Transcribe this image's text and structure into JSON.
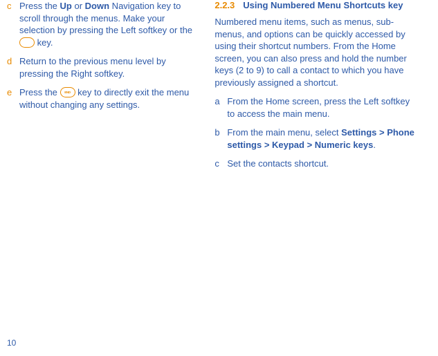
{
  "page_number": "10",
  "left": {
    "items": [
      {
        "marker": "c",
        "segments": [
          {
            "text": "Press the "
          },
          {
            "text": "Up",
            "bold": true
          },
          {
            "text": " or "
          },
          {
            "text": "Down",
            "bold": true
          },
          {
            "text": " Navigation key to scroll through the menus. Make your selection by pressing the Left softkey or the "
          },
          {
            "icon": "ok-key"
          },
          {
            "text": " key."
          }
        ]
      },
      {
        "marker": "d",
        "segments": [
          {
            "text": "Return to the previous menu level by pressing the Right softkey."
          }
        ]
      },
      {
        "marker": "e",
        "segments": [
          {
            "text": "Press the "
          },
          {
            "icon": "end-key",
            "label": "END"
          },
          {
            "text": " key to directly exit the menu without changing any settings."
          }
        ]
      }
    ]
  },
  "right": {
    "section_number": "2.2.3",
    "section_title": "Using Numbered Menu Shortcuts key",
    "intro": "Numbered menu items, such as menus, sub-menus, and options can be quickly accessed by using their shortcut numbers. From the Home screen, you can also press and hold the number keys (2 to 9) to call a contact to which you have previously assigned a shortcut.",
    "items": [
      {
        "marker": "a",
        "segments": [
          {
            "text": "From the Home screen, press the Left softkey to access the main menu."
          }
        ]
      },
      {
        "marker": "b",
        "segments": [
          {
            "text": "From the main menu, select "
          },
          {
            "text": "Settings > Phone settings > Keypad > Numeric keys",
            "bold": true
          },
          {
            "text": "."
          }
        ]
      },
      {
        "marker": "c",
        "segments": [
          {
            "text": "Set the contacts shortcut."
          }
        ]
      }
    ]
  }
}
